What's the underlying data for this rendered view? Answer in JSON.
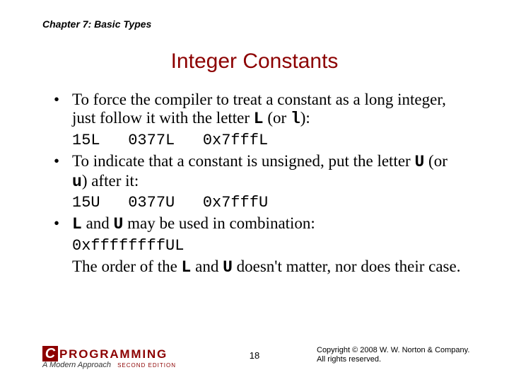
{
  "chapter": "Chapter 7: Basic Types",
  "title": "Integer Constants",
  "bullets": {
    "b1_pre": "To force the compiler to treat a constant as a long integer, just follow it with the letter ",
    "b1_L": "L",
    "b1_mid": " (or ",
    "b1_l": "l",
    "b1_post": "):",
    "code1": "15L   0377L   0x7fffL",
    "b2_pre": "To indicate that a constant is unsigned, put the letter ",
    "b2_U": "U",
    "b2_mid": " (or ",
    "b2_u": "u",
    "b2_post": ") after it:",
    "code2": "15U   0377U   0x7fffU",
    "b3_L": "L",
    "b3_mid1": " and ",
    "b3_U": "U",
    "b3_mid2": " may be used in combination:",
    "code3": "0xffffffffUL",
    "b3_order_pre": "The order of the ",
    "b3_order_L": "L",
    "b3_order_mid": " and ",
    "b3_order_U": "U",
    "b3_order_post": " doesn't matter, nor does their case."
  },
  "footer": {
    "logo_c": "C",
    "logo_prog": "PROGRAMMING",
    "logo_sub": "A Modern Approach",
    "logo_ed": "SECOND EDITION",
    "page": "18",
    "copy1": "Copyright © 2008 W. W. Norton & Company.",
    "copy2": "All rights reserved."
  }
}
